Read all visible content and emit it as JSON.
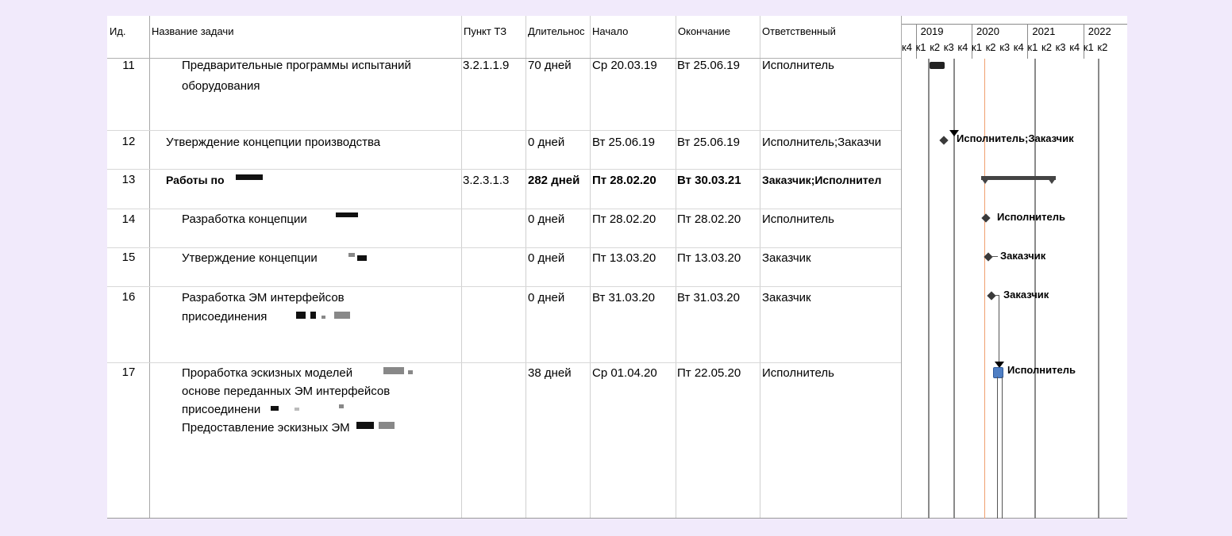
{
  "header": {
    "id": "Ид.",
    "name": "Название задачи",
    "punkt": "Пункт ТЗ",
    "duration": "Длительнос",
    "start": "Начало",
    "end": "Окончание",
    "responsible": "Ответственный"
  },
  "timeline": {
    "years": [
      "2019",
      "2020",
      "2021",
      "2022"
    ],
    "quarters": [
      "к4",
      "к1",
      "к2",
      "к3",
      "к4",
      "к1",
      "к2",
      "к3",
      "к4",
      "к1",
      "к2",
      "к3",
      "к4",
      "к1",
      "к2"
    ]
  },
  "tasks": [
    {
      "id": "11",
      "name_lines": [
        "Предварительные программы испытаний",
        "оборудования"
      ],
      "punkt": "3.2.1.1.9",
      "duration": "70 дней",
      "start": "Ср 20.03.19",
      "end": "Вт 25.06.19",
      "responsible": "Исполнитель",
      "bold": false
    },
    {
      "id": "12",
      "name_lines": [
        "Утверждение концепции производства"
      ],
      "punkt": "",
      "duration": "0 дней",
      "start": "Вт 25.06.19",
      "end": "Вт 25.06.19",
      "responsible": "Исполнитель;Заказчи",
      "bold": false
    },
    {
      "id": "13",
      "name_lines": [
        "Работы по"
      ],
      "punkt": "3.2.3.1.3",
      "duration": "282 дней",
      "start": "Пт 28.02.20",
      "end": "Вт 30.03.21",
      "responsible": "Заказчик;Исполнител",
      "bold": true
    },
    {
      "id": "14",
      "name_lines": [
        "Разработка концепции"
      ],
      "punkt": "",
      "duration": "0 дней",
      "start": "Пт 28.02.20",
      "end": "Пт 28.02.20",
      "responsible": "Исполнитель",
      "bold": false
    },
    {
      "id": "15",
      "name_lines": [
        "Утверждение концепции"
      ],
      "punkt": "",
      "duration": "0 дней",
      "start": "Пт 13.03.20",
      "end": "Пт 13.03.20",
      "responsible": "Заказчик",
      "bold": false
    },
    {
      "id": "16",
      "name_lines": [
        "Разработка ЭМ интерфейсов",
        "присоединения"
      ],
      "punkt": "",
      "duration": "0 дней",
      "start": "Вт 31.03.20",
      "end": "Вт 31.03.20",
      "responsible": "Заказчик",
      "bold": false
    },
    {
      "id": "17",
      "name_lines": [
        "Проработка эскизных моделей",
        "основе переданных ЭМ интерфейсов",
        "присоединени",
        "Предоставление эскизных ЭМ"
      ],
      "punkt": "",
      "duration": "38 дней",
      "start": "Ср 01.04.20",
      "end": "Пт 22.05.20",
      "responsible": "Исполнитель",
      "bold": false
    }
  ],
  "gantt_labels": {
    "t12": "Исполнитель;Заказчик",
    "t14": "Исполнитель",
    "t15": "Заказчик",
    "t16": "Заказчик",
    "t17": "Исполнитель"
  },
  "colors": {
    "background": "#f1eafb",
    "today_line": "#f0a070",
    "summary_bar": "#444444",
    "task_bar": "#4f7fc4"
  }
}
